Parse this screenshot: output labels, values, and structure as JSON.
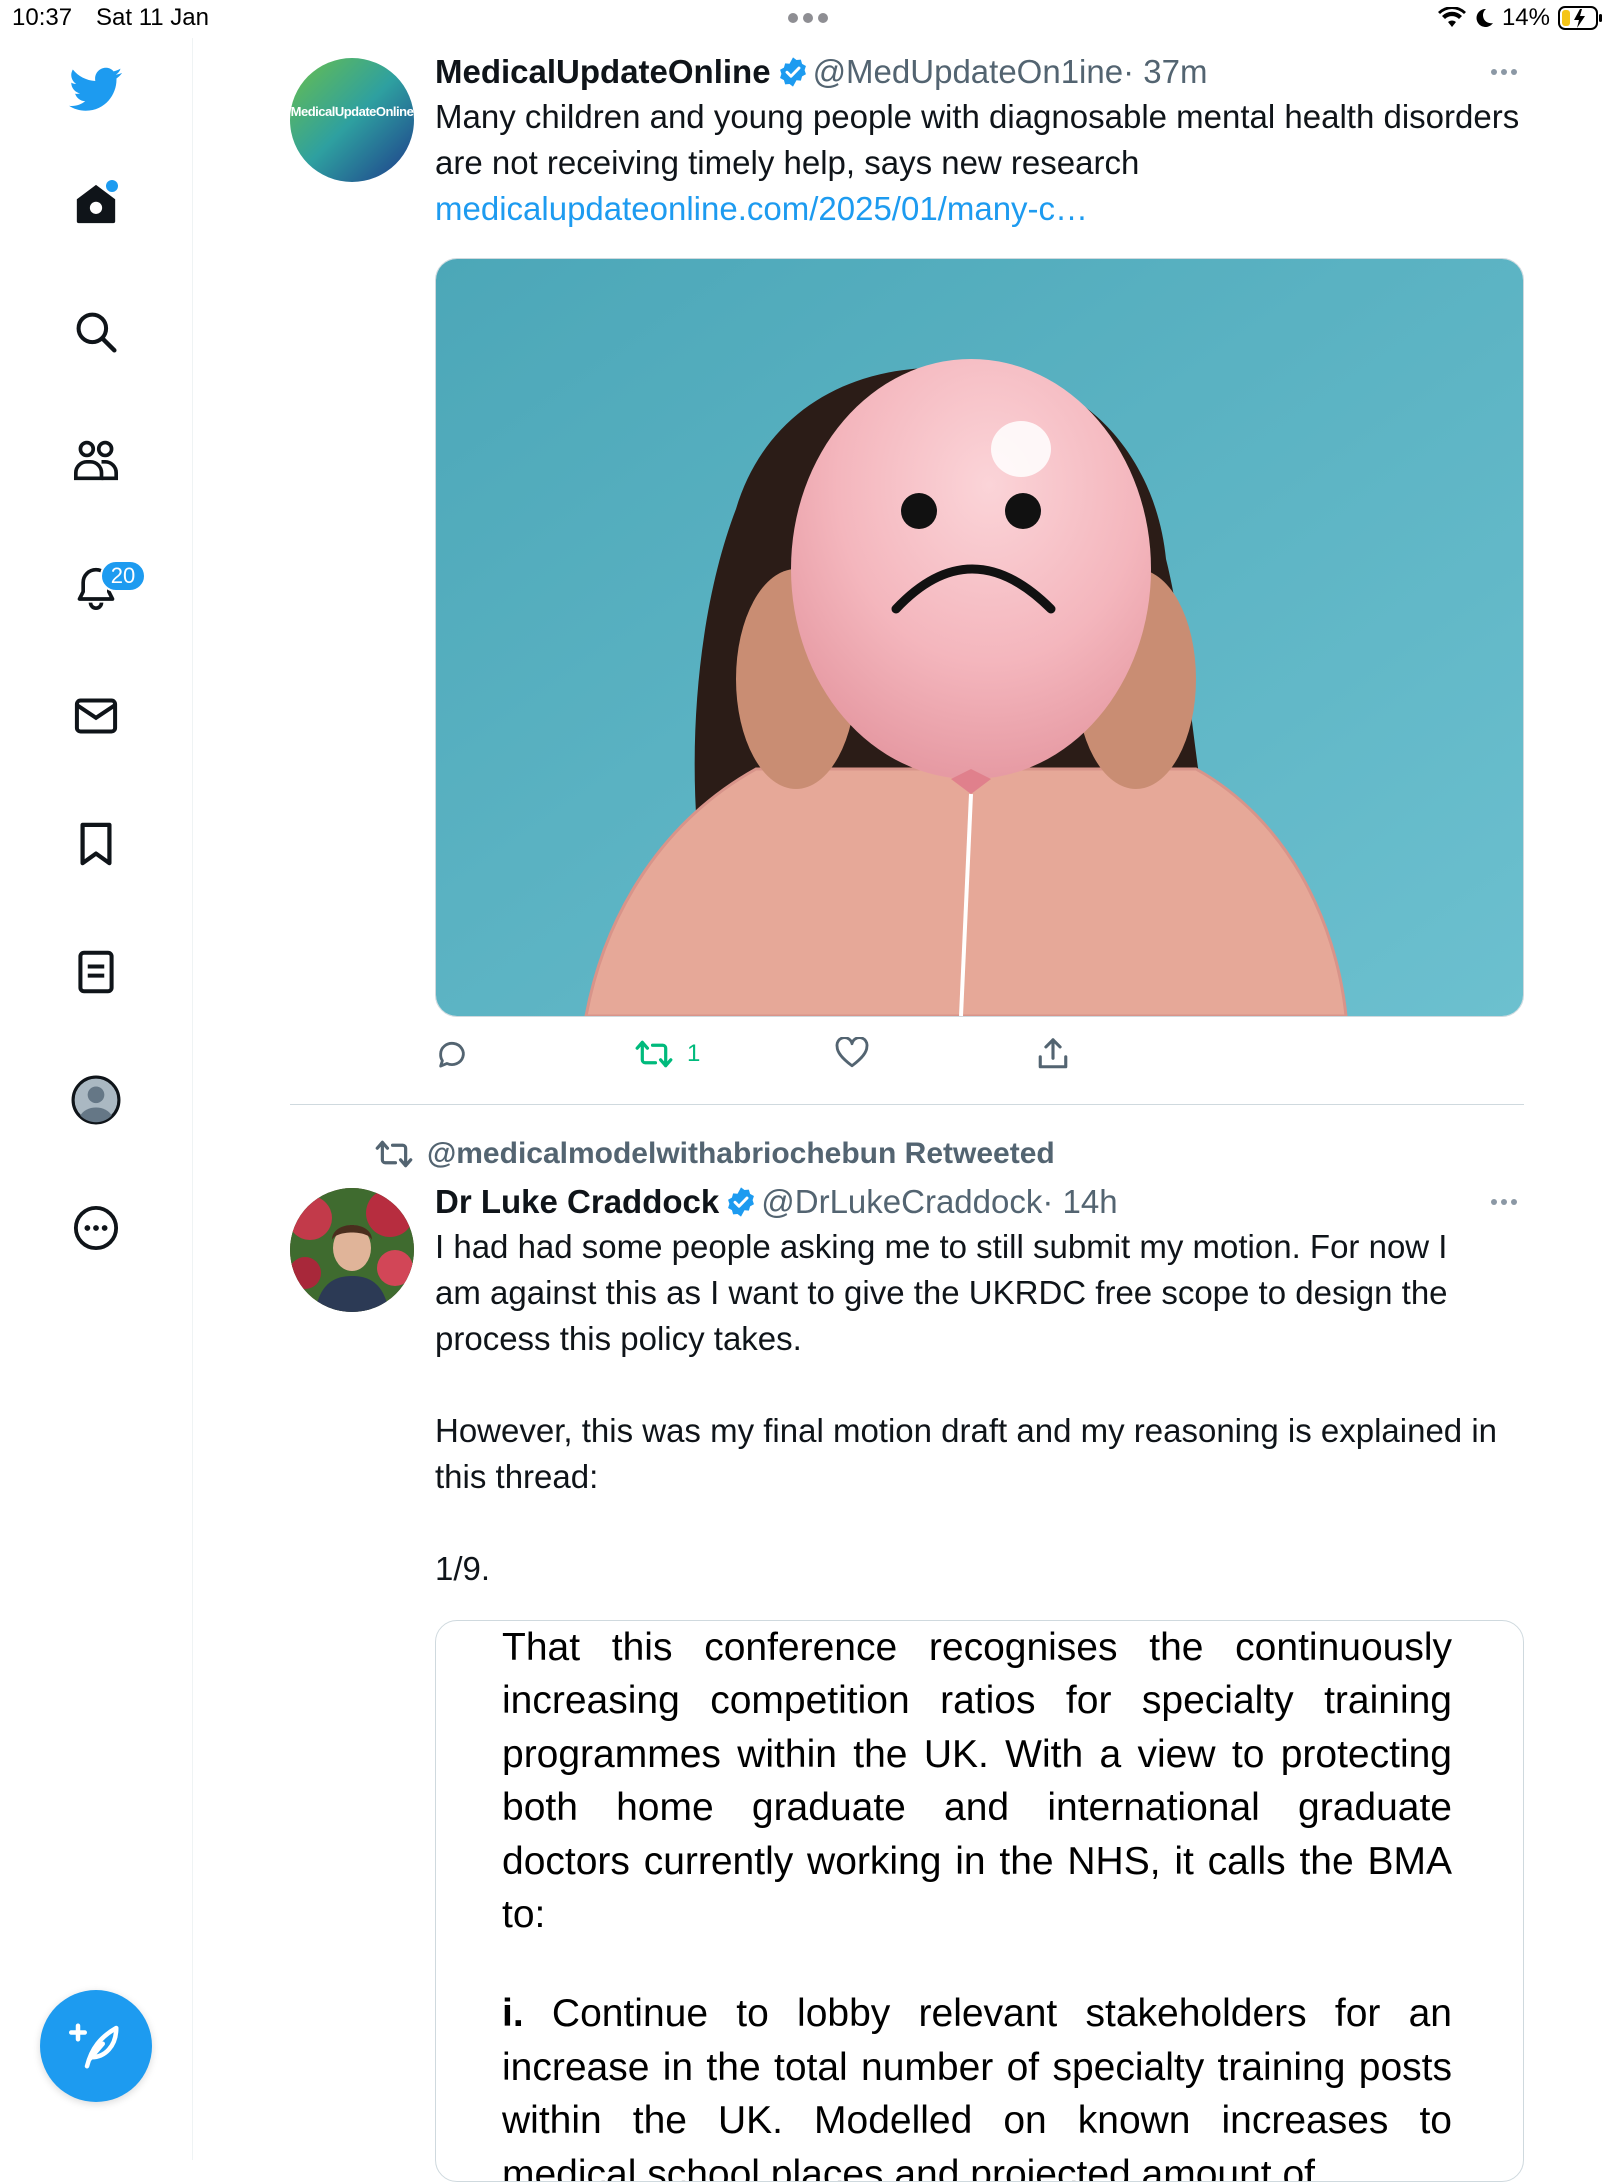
{
  "status_bar": {
    "time": "10:37",
    "date": "Sat 11 Jan",
    "battery": "14%"
  },
  "sidebar": {
    "items": [
      {
        "icon": "twitter-bird-icon"
      },
      {
        "icon": "home-icon"
      },
      {
        "icon": "search-icon"
      },
      {
        "icon": "communities-icon"
      },
      {
        "icon": "notifications-bell-icon",
        "badge": "20"
      },
      {
        "icon": "messages-envelope-icon"
      },
      {
        "icon": "bookmark-icon"
      },
      {
        "icon": "lists-icon"
      },
      {
        "icon": "profile-avatar-icon"
      },
      {
        "icon": "more-circle-icon"
      }
    ],
    "compose_icon": "compose-feather-icon"
  },
  "tweets": [
    {
      "name": "MedicalUpdateOnline",
      "handle": "@MedUpdateOn1ine",
      "time": "· 37m",
      "avatar_text": "MedicalUpdateOnline",
      "text": "Many children and young people with diagnosable mental health disorders are not receiving timely help, says new research",
      "link": "medicalupdateonline.com/2025/01/many-c…",
      "media": "photo-woman-holding-sad-face-balloon",
      "retweet_count": "1"
    },
    {
      "retweeted_by": "@medicalmodelwithabriochebun Retweeted",
      "name": "Dr Luke Craddock",
      "handle": "@DrLukeCraddock",
      "time": "· 14h",
      "text_p1": "I had had some people asking me to still submit my motion. For now I am against this as I want to give the UKRDC free scope to design the process this policy takes.",
      "text_p2": "However, this was my final motion draft and my reasoning is explained in this thread:",
      "text_p3": "1/9.",
      "document": {
        "para1": "That this conference recognises the continuously increasing competition ratios for specialty training programmes within the UK. With a view to protecting both home graduate and international graduate doctors currently working in the NHS, it calls the BMA to:",
        "para2_label": "i.",
        "para2": "Continue to lobby relevant stakeholders for an increase in the total number of specialty training posts within the UK. Modelled on known increases to medical school places and projected amount of"
      }
    }
  ],
  "colors": {
    "accent": "#1d9bf0",
    "retweet_green": "#00ba7c",
    "secondary_text": "#536471"
  }
}
